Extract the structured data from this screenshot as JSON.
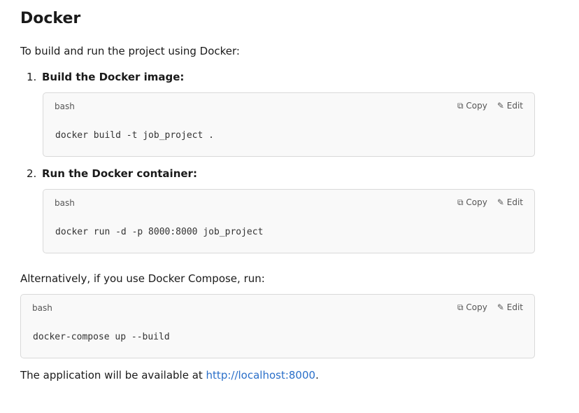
{
  "heading": "Docker",
  "intro": "To build and run the project using Docker:",
  "steps": [
    {
      "num": "1.",
      "label": "Build the Docker image:",
      "lang": "bash",
      "code": "docker build -t job_project ."
    },
    {
      "num": "2.",
      "label": "Run the Docker container:",
      "lang": "bash",
      "code": "docker run -d -p 8000:8000 job_project"
    }
  ],
  "alt_text": "Alternatively, if you use Docker Compose, run:",
  "compose": {
    "lang": "bash",
    "code": "docker-compose up --build"
  },
  "actions": {
    "copy": "Copy",
    "edit": "Edit"
  },
  "footer": {
    "prefix": "The application will be available at ",
    "link": "http://localhost:8000",
    "suffix": "."
  }
}
